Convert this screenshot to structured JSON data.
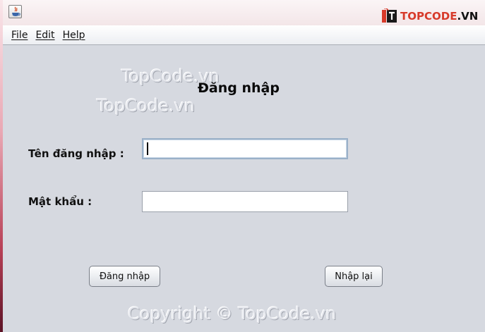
{
  "titlebar": {
    "logo_brand": "TOPCODE",
    "logo_suffix": ".VN"
  },
  "menu": {
    "items": [
      {
        "label": "File"
      },
      {
        "label": "Edit"
      },
      {
        "label": "Help"
      }
    ]
  },
  "form": {
    "title": "Đăng nhập",
    "username_label": "Tên đăng nhập :",
    "username_value": "",
    "password_label": "Mật khẩu :",
    "password_value": "",
    "login_button": "Đăng nhập",
    "reset_button": "Nhập lại"
  },
  "watermarks": {
    "top1": "TopCode.vn",
    "top2": "TopCode.vn",
    "bottom": "Copyright © TopCode.vn"
  },
  "icons": {
    "app": "java-app-icon",
    "logo": "topcode-logo-icon"
  },
  "colors": {
    "window_bg": "#d6d9e0",
    "logo_accent": "#d73a2a"
  }
}
